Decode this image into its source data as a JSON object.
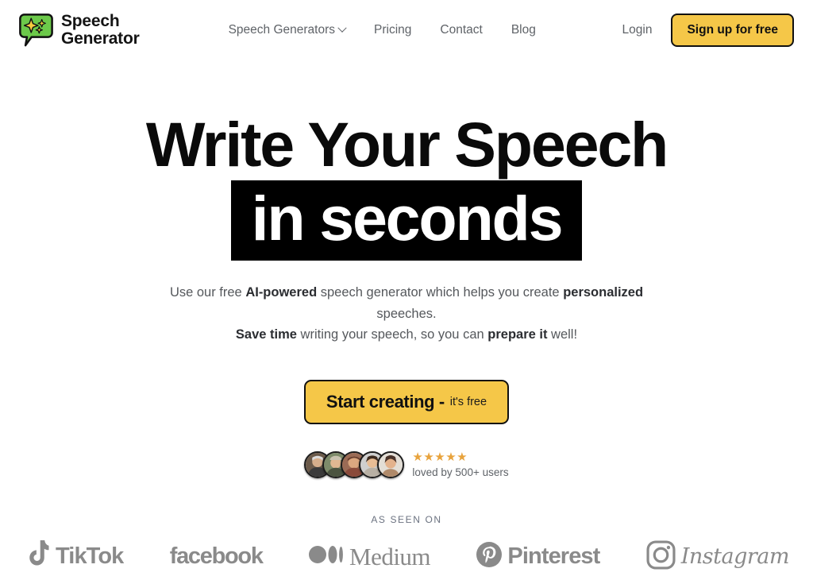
{
  "colors": {
    "accent_yellow": "#F5C748",
    "logo_green": "#6CC94A",
    "star_orange": "#E8A33D",
    "body_gray": "#5f6368",
    "logo_gray": "#8a8a8a",
    "highlight_black": "#000000"
  },
  "header": {
    "brand": {
      "line1": "Speech",
      "line2": "Generator",
      "icon": "speech-bubble-sparkle-logo"
    },
    "nav": [
      {
        "label": "Speech Generators",
        "has_dropdown": true
      },
      {
        "label": "Pricing",
        "has_dropdown": false
      },
      {
        "label": "Contact",
        "has_dropdown": false
      },
      {
        "label": "Blog",
        "has_dropdown": false
      }
    ],
    "login_label": "Login",
    "signup_label": "Sign up for free"
  },
  "hero": {
    "headline_line1": "Write Your Speech",
    "headline_line2": "in seconds",
    "sub_line1_a": "Use our free ",
    "sub_line1_b": "AI-powered",
    "sub_line1_c": " speech generator which helps you create ",
    "sub_line1_d": "personalized",
    "sub_line1_e": " speeches.",
    "sub_line2_a": "Save time",
    "sub_line2_b": " writing your speech, so you can ",
    "sub_line2_c": "prepare it",
    "sub_line2_d": " well!",
    "cta_main": "Start creating -",
    "cta_sub": "it's free"
  },
  "social_proof": {
    "stars": "★★★★★",
    "star_count": 5,
    "text": "loved by 500+ users",
    "avatar_count": 5
  },
  "as_seen_on": {
    "label": "AS SEEN ON",
    "brands": [
      {
        "name": "TikTok",
        "icon": "tiktok-icon"
      },
      {
        "name": "facebook",
        "icon": "facebook-wordmark"
      },
      {
        "name": "Medium",
        "icon": "medium-icon"
      },
      {
        "name": "Pinterest",
        "icon": "pinterest-icon"
      },
      {
        "name": "Instagram",
        "icon": "instagram-icon"
      }
    ]
  }
}
